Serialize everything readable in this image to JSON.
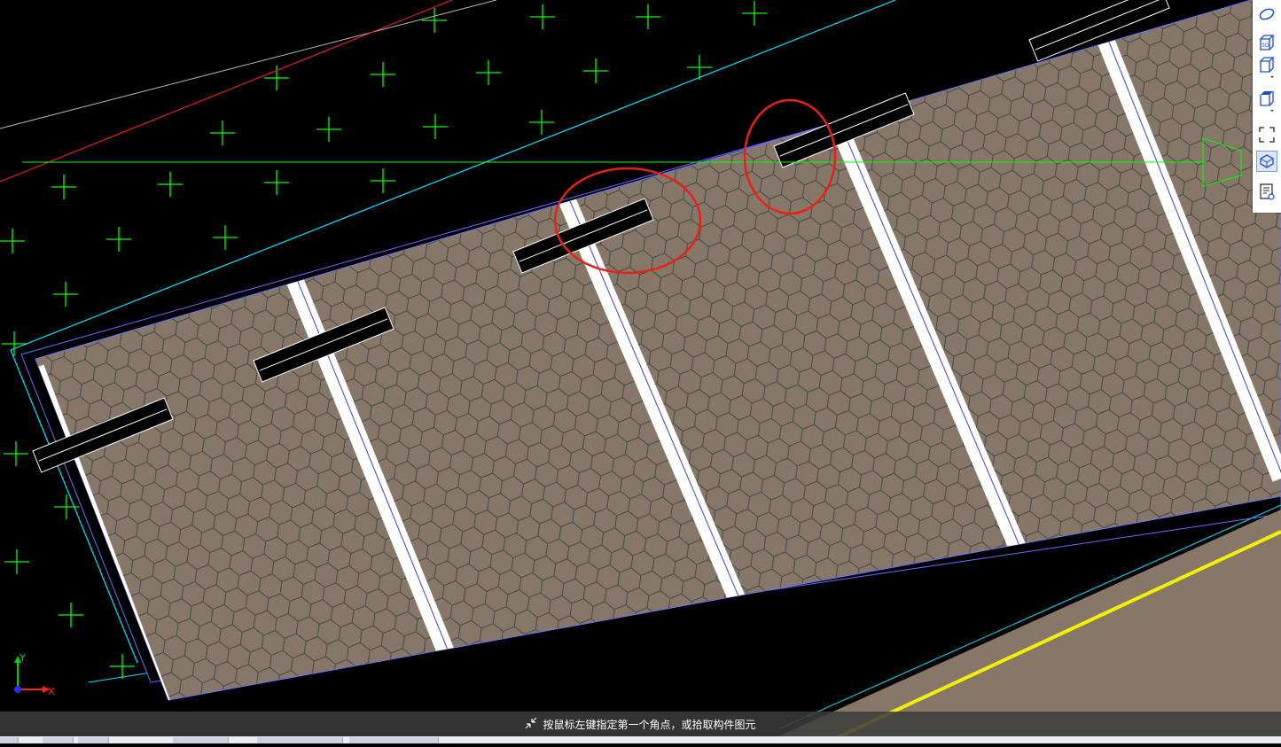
{
  "viewport": {
    "hint_text": "按鼠标左键指定第一个角点，或拾取构件图元",
    "hint_icon": "collapse-arrows-icon",
    "axis": {
      "x_label": "X",
      "y_label": "Y"
    }
  },
  "toolbar": {
    "items": [
      {
        "name": "orbit-icon",
        "label": ""
      },
      {
        "name": "view-3d-icon",
        "label": "3D"
      },
      {
        "name": "view-cube-dropdown-icon",
        "label": ""
      },
      {
        "name": "view-box-dropdown-icon",
        "label": ""
      },
      {
        "name": "zoom-extents-icon",
        "label": ""
      },
      {
        "name": "display-settings-icon",
        "label": ""
      },
      {
        "name": "properties-list-icon",
        "label": ""
      }
    ]
  },
  "colors": {
    "canvas_bg": "#000000",
    "slab_fill": "#877769",
    "hex_stroke": "#3e4a44",
    "beam_fill": "#ffffff",
    "grid_green": "#00ff00",
    "cyan_line": "#00e5ff",
    "annotation_red": "#e8201a",
    "yellow_line": "#f0f000",
    "opening_fill": "#000000"
  }
}
